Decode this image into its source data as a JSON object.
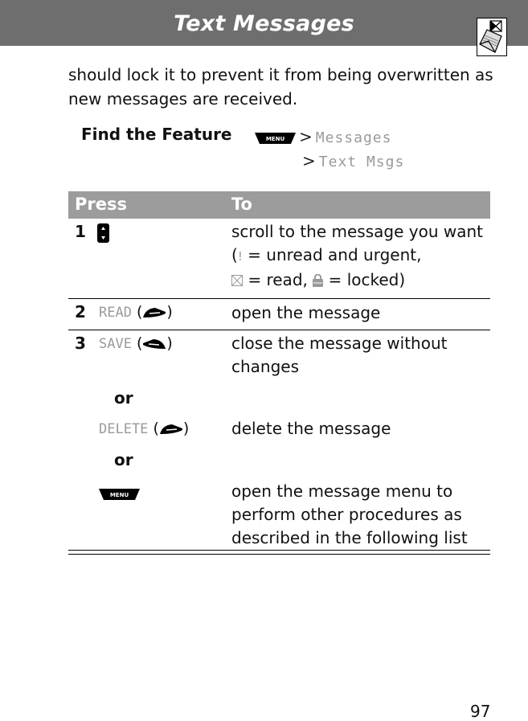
{
  "header": {
    "title": "Text Messages",
    "icon": "text-messages-section-icon"
  },
  "intro": "should lock it to prevent it from being overwritten as new messages are received.",
  "find_the_feature": {
    "label": "Find the Feature",
    "key": "MENU",
    "path": [
      {
        "sep": ">",
        "item": "Messages"
      },
      {
        "sep": ">",
        "item": "Text Msgs"
      }
    ]
  },
  "table": {
    "headers": {
      "press": "Press",
      "to": "To"
    },
    "rows": [
      {
        "num": "1",
        "press_icon": "navigation-key-icon",
        "to_line1": "scroll to the message you want",
        "to_line2_pre": "(",
        "to_line2_sym": "!",
        "to_line2_post": " = unread and urgent,",
        "to_line3_mid": " = read, ",
        "to_line3_post": " = locked)"
      },
      {
        "num": "2",
        "press": "READ",
        "press_icon": "right-soft-key-icon",
        "to": "open the message"
      },
      {
        "num": "3",
        "press": "SAVE",
        "press_icon": "left-soft-key-icon",
        "to": "close the message without changes"
      },
      {
        "or": "or"
      },
      {
        "press": "DELETE",
        "press_icon": "right-soft-key-icon",
        "to": "delete the message"
      },
      {
        "or": "or"
      },
      {
        "press_icon": "menu-key-icon",
        "to": "open the message menu to perform other procedures as described in the following list"
      }
    ]
  },
  "page_number": "97"
}
